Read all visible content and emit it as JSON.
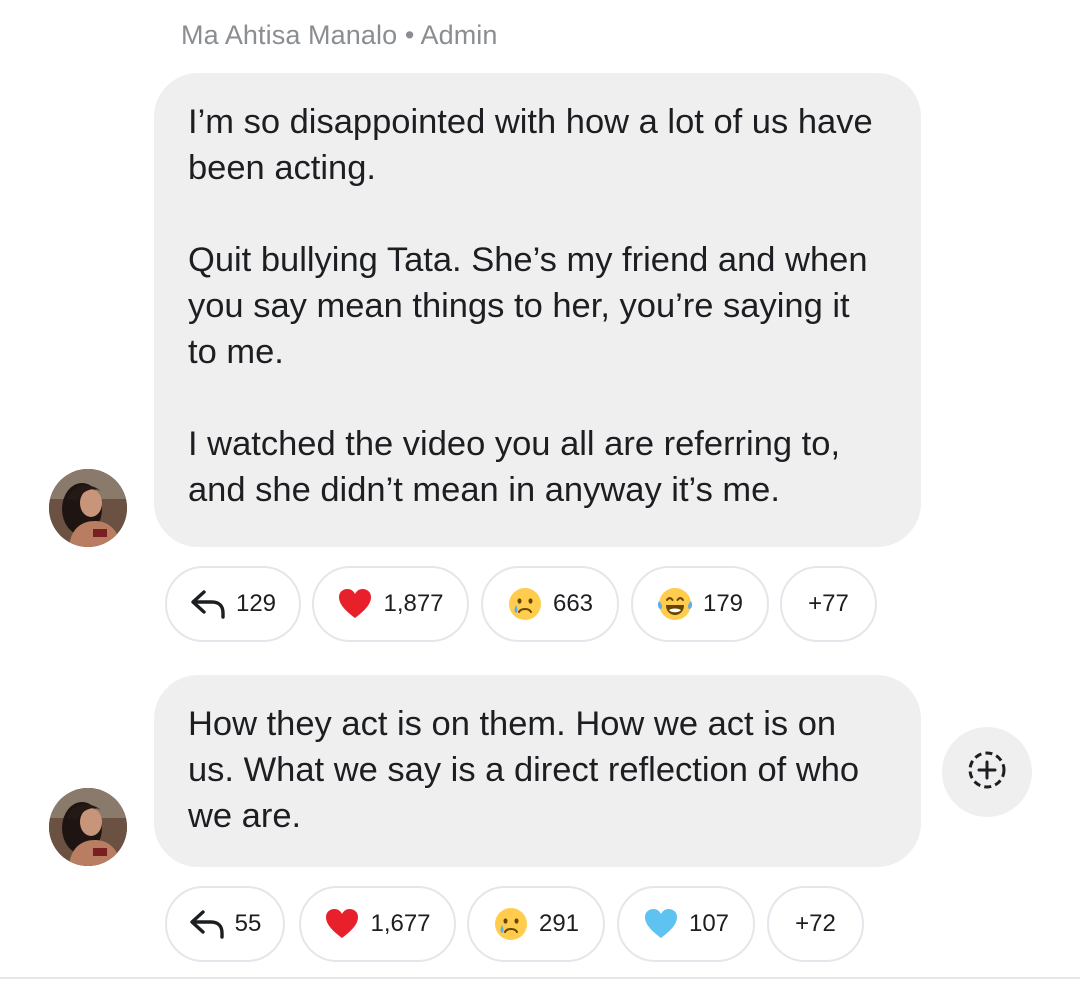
{
  "header": {
    "sender_line": "Ma Ahtisa Manalo • Admin"
  },
  "messages": [
    {
      "paragraphs": [
        "I’m so disappointed with how a lot of us have been acting.",
        "Quit bullying Tata. She’s my friend and when you say mean things to her, you’re saying it to me.",
        "I watched the video you all are referring to, and she didn’t mean in anyway it’s me."
      ],
      "reactions": {
        "replies": "129",
        "heart": "1,877",
        "crying": "663",
        "laughing": "179",
        "more": "+77"
      }
    },
    {
      "paragraphs": [
        "How they act is on them. How we act is on us. What we say is a direct reflection of who we are."
      ],
      "reactions": {
        "replies": "55",
        "heart": "1,677",
        "crying": "291",
        "blue_heart": "107",
        "more": "+72"
      }
    }
  ],
  "icons": {
    "reply": "reply-arrow-icon",
    "heart": "red-heart-icon",
    "crying": "crying-face-icon",
    "laughing": "tears-of-joy-icon",
    "blue_heart": "blue-heart-icon",
    "add_reaction": "add-reaction-icon"
  },
  "colors": {
    "bubble_background": "#efefef",
    "sender_text": "#8a8d91",
    "chip_border": "#e4e6eb",
    "red_heart": "#e8202c",
    "blue_heart": "#5ec3f0",
    "emoji_yellow": "#ffcc4d"
  }
}
